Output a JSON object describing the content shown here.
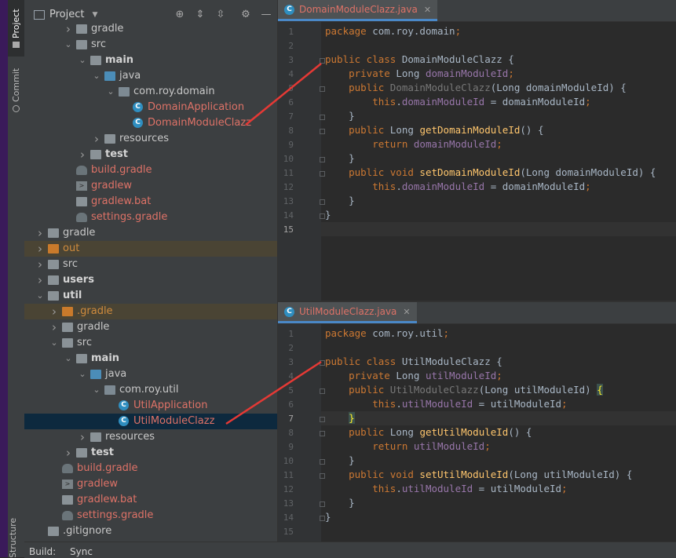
{
  "side_tabs": {
    "project": "Project",
    "commit": "Commit",
    "structure": "Structure"
  },
  "project_panel": {
    "title": "Project",
    "toolbar_icons": [
      "locate-icon",
      "expand-all-icon",
      "collapse-all-icon",
      "gear-icon",
      "minimize-icon"
    ],
    "tree": [
      {
        "label": "gradle",
        "indent": 3,
        "arrow": "right",
        "icon": "folder"
      },
      {
        "label": "src",
        "indent": 3,
        "arrow": "down",
        "icon": "folder"
      },
      {
        "label": "main",
        "indent": 4,
        "arrow": "down",
        "icon": "folder",
        "bold": true
      },
      {
        "label": "java",
        "indent": 5,
        "arrow": "down",
        "icon": "folder-blue"
      },
      {
        "label": "com.roy.domain",
        "indent": 6,
        "arrow": "down",
        "icon": "package"
      },
      {
        "label": "DomainApplication",
        "indent": 7,
        "icon": "class-run",
        "color": "red"
      },
      {
        "label": "DomainModuleClazz",
        "indent": 7,
        "icon": "class",
        "color": "red"
      },
      {
        "label": "resources",
        "indent": 5,
        "arrow": "right",
        "icon": "folder"
      },
      {
        "label": "test",
        "indent": 4,
        "arrow": "right",
        "icon": "folder",
        "bold": true
      },
      {
        "label": "build.gradle",
        "indent": 3,
        "icon": "gradle",
        "color": "red"
      },
      {
        "label": "gradlew",
        "indent": 3,
        "icon": "terminal",
        "color": "red"
      },
      {
        "label": "gradlew.bat",
        "indent": 3,
        "icon": "bat",
        "color": "red"
      },
      {
        "label": "settings.gradle",
        "indent": 3,
        "icon": "gradle",
        "color": "red"
      },
      {
        "label": "gradle",
        "indent": 1,
        "arrow": "right",
        "icon": "folder"
      },
      {
        "label": "out",
        "indent": 1,
        "arrow": "right",
        "icon": "folder-orange",
        "color": "orange",
        "highlight": true
      },
      {
        "label": "src",
        "indent": 1,
        "arrow": "right",
        "icon": "folder"
      },
      {
        "label": "users",
        "indent": 1,
        "arrow": "right",
        "icon": "folder",
        "bold": true
      },
      {
        "label": "util",
        "indent": 1,
        "arrow": "down",
        "icon": "folder",
        "bold": true
      },
      {
        "label": ".gradle",
        "indent": 2,
        "arrow": "right",
        "icon": "folder-orange",
        "color": "orange",
        "highlight": true
      },
      {
        "label": "gradle",
        "indent": 2,
        "arrow": "right",
        "icon": "folder"
      },
      {
        "label": "src",
        "indent": 2,
        "arrow": "down",
        "icon": "folder"
      },
      {
        "label": "main",
        "indent": 3,
        "arrow": "down",
        "icon": "folder",
        "bold": true
      },
      {
        "label": "java",
        "indent": 4,
        "arrow": "down",
        "icon": "folder-blue"
      },
      {
        "label": "com.roy.util",
        "indent": 5,
        "arrow": "down",
        "icon": "package"
      },
      {
        "label": "UtilApplication",
        "indent": 6,
        "icon": "class-run",
        "color": "red"
      },
      {
        "label": "UtilModuleClazz",
        "indent": 6,
        "icon": "class",
        "color": "red",
        "selected": true
      },
      {
        "label": "resources",
        "indent": 4,
        "arrow": "right",
        "icon": "folder"
      },
      {
        "label": "test",
        "indent": 3,
        "arrow": "right",
        "icon": "folder",
        "bold": true
      },
      {
        "label": "build.gradle",
        "indent": 2,
        "icon": "gradle",
        "color": "red"
      },
      {
        "label": "gradlew",
        "indent": 2,
        "icon": "terminal",
        "color": "red"
      },
      {
        "label": "gradlew.bat",
        "indent": 2,
        "icon": "bat",
        "color": "red"
      },
      {
        "label": "settings.gradle",
        "indent": 2,
        "icon": "gradle",
        "color": "red"
      },
      {
        "label": ".gitignore",
        "indent": 1,
        "icon": "gitignore"
      }
    ]
  },
  "bottom_bar": {
    "build": "Build:",
    "sync": "Sync"
  },
  "editors": [
    {
      "tab": "DomainModuleClazz.java",
      "current_line": 15,
      "lines": [
        [
          {
            "t": "package ",
            "c": "kw"
          },
          {
            "t": "com.roy.domain",
            "c": "nm"
          },
          {
            "t": ";",
            "c": "kw"
          }
        ],
        [],
        [
          {
            "t": "public class ",
            "c": "kw"
          },
          {
            "t": "DomainModuleClazz {",
            "c": "nm"
          }
        ],
        [
          {
            "t": "    private ",
            "c": "kw"
          },
          {
            "t": "Long ",
            "c": "nm"
          },
          {
            "t": "domainModuleId",
            "c": "fd"
          },
          {
            "t": ";",
            "c": "kw"
          }
        ],
        [
          {
            "t": "    public ",
            "c": "kw"
          },
          {
            "t": "DomainModuleClazz",
            "c": "dim"
          },
          {
            "t": "(Long domainModuleId) {",
            "c": "nm"
          }
        ],
        [
          {
            "t": "        this",
            "c": "kw"
          },
          {
            "t": ".",
            "c": "nm"
          },
          {
            "t": "domainModuleId",
            "c": "fd"
          },
          {
            "t": " = domainModuleId",
            "c": "nm"
          },
          {
            "t": ";",
            "c": "kw"
          }
        ],
        [
          {
            "t": "    }",
            "c": "nm"
          }
        ],
        [
          {
            "t": "    public ",
            "c": "kw"
          },
          {
            "t": "Long ",
            "c": "nm"
          },
          {
            "t": "getDomainModuleId",
            "c": "fn"
          },
          {
            "t": "() {",
            "c": "nm"
          }
        ],
        [
          {
            "t": "        return ",
            "c": "kw"
          },
          {
            "t": "domainModuleId",
            "c": "fd"
          },
          {
            "t": ";",
            "c": "kw"
          }
        ],
        [
          {
            "t": "    }",
            "c": "nm"
          }
        ],
        [
          {
            "t": "    public void ",
            "c": "kw"
          },
          {
            "t": "setDomainModuleId",
            "c": "fn"
          },
          {
            "t": "(Long domainModuleId) {",
            "c": "nm"
          }
        ],
        [
          {
            "t": "        this",
            "c": "kw"
          },
          {
            "t": ".",
            "c": "nm"
          },
          {
            "t": "domainModuleId",
            "c": "fd"
          },
          {
            "t": " = domainModuleId",
            "c": "nm"
          },
          {
            "t": ";",
            "c": "kw"
          }
        ],
        [
          {
            "t": "    }",
            "c": "nm"
          }
        ],
        [
          {
            "t": "}",
            "c": "nm"
          }
        ],
        []
      ]
    },
    {
      "tab": "UtilModuleClazz.java",
      "current_line": 7,
      "lines": [
        [
          {
            "t": "package ",
            "c": "kw"
          },
          {
            "t": "com.roy.util",
            "c": "nm"
          },
          {
            "t": ";",
            "c": "kw"
          }
        ],
        [],
        [
          {
            "t": "public class ",
            "c": "kw"
          },
          {
            "t": "UtilModuleClazz {",
            "c": "nm"
          }
        ],
        [
          {
            "t": "    private ",
            "c": "kw"
          },
          {
            "t": "Long ",
            "c": "nm"
          },
          {
            "t": "utilModuleId",
            "c": "fd"
          },
          {
            "t": ";",
            "c": "kw"
          }
        ],
        [
          {
            "t": "    public ",
            "c": "kw"
          },
          {
            "t": "UtilModuleClazz",
            "c": "dim"
          },
          {
            "t": "(Long utilModuleId) ",
            "c": "nm"
          },
          {
            "t": "{",
            "c": "brk"
          }
        ],
        [
          {
            "t": "        this",
            "c": "kw"
          },
          {
            "t": ".",
            "c": "nm"
          },
          {
            "t": "utilModuleId",
            "c": "fd"
          },
          {
            "t": " = utilModuleId",
            "c": "nm"
          },
          {
            "t": ";",
            "c": "kw"
          }
        ],
        [
          {
            "t": "    ",
            "c": "nm"
          },
          {
            "t": "}",
            "c": "brk"
          }
        ],
        [
          {
            "t": "    public ",
            "c": "kw"
          },
          {
            "t": "Long ",
            "c": "nm"
          },
          {
            "t": "getUtilModuleId",
            "c": "fn"
          },
          {
            "t": "() {",
            "c": "nm"
          }
        ],
        [
          {
            "t": "        return ",
            "c": "kw"
          },
          {
            "t": "utilModuleId",
            "c": "fd"
          },
          {
            "t": ";",
            "c": "kw"
          }
        ],
        [
          {
            "t": "    }",
            "c": "nm"
          }
        ],
        [
          {
            "t": "    public void ",
            "c": "kw"
          },
          {
            "t": "setUtilModuleId",
            "c": "fn"
          },
          {
            "t": "(Long utilModuleId) {",
            "c": "nm"
          }
        ],
        [
          {
            "t": "        this",
            "c": "kw"
          },
          {
            "t": ".",
            "c": "nm"
          },
          {
            "t": "utilModuleId",
            "c": "fd"
          },
          {
            "t": " = utilModuleId",
            "c": "nm"
          },
          {
            "t": ";",
            "c": "kw"
          }
        ],
        [
          {
            "t": "    }",
            "c": "nm"
          }
        ],
        [
          {
            "t": "}",
            "c": "nm"
          }
        ],
        []
      ]
    }
  ]
}
